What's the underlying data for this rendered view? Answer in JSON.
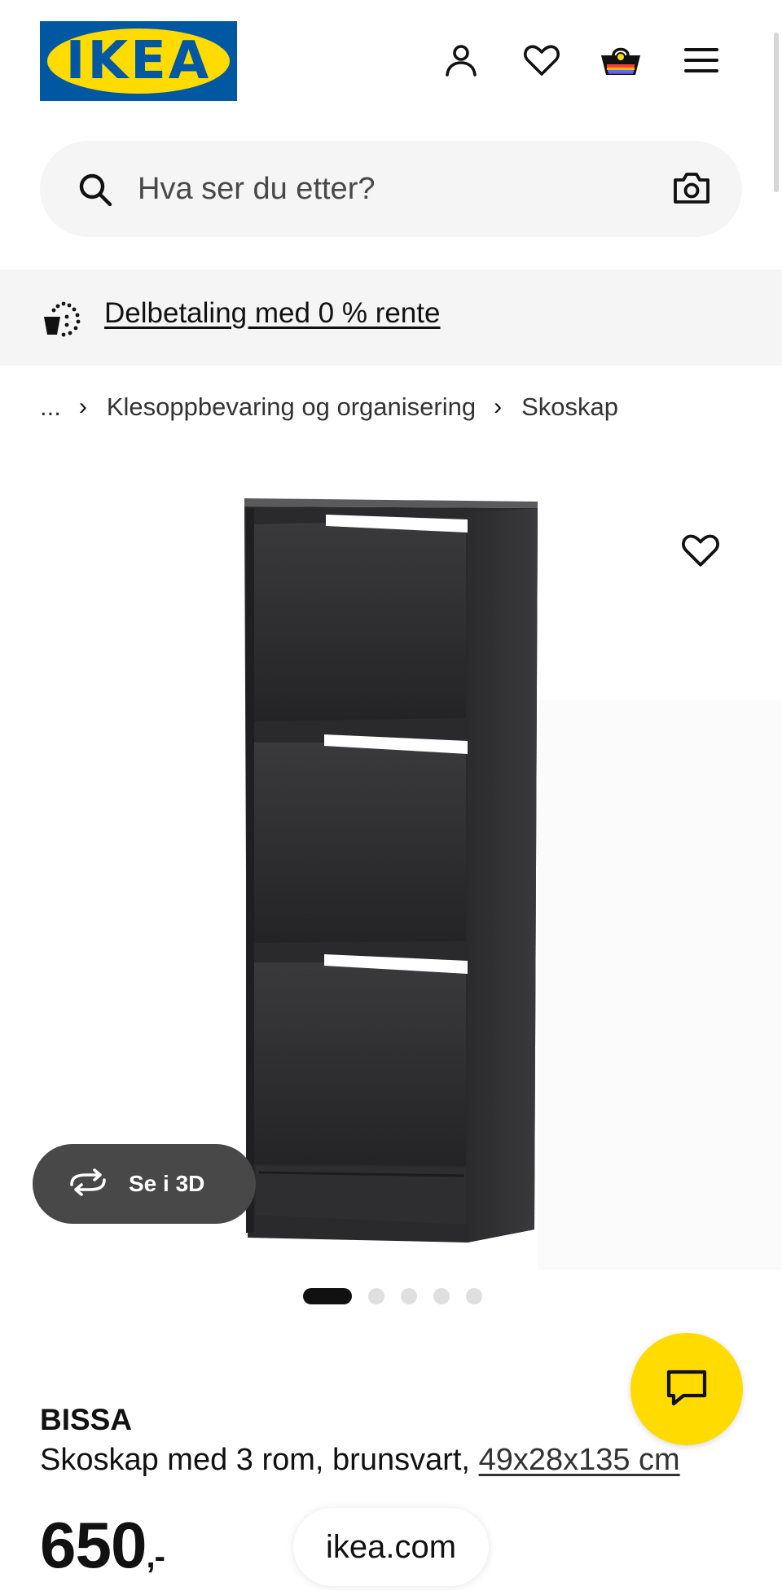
{
  "header": {
    "logo_text": "IKEA",
    "logo_reg": "®",
    "icons": [
      "user-icon",
      "heart-icon",
      "basket-icon",
      "menu-icon"
    ]
  },
  "search": {
    "placeholder": "Hva ser du etter?",
    "icons": [
      "search-icon",
      "camera-icon"
    ]
  },
  "banner": {
    "link_text": "Delbetaling med 0 % rente",
    "icon": "installment-icon"
  },
  "breadcrumb": {
    "ellipsis": "...",
    "separator": "›",
    "items": [
      "Klesoppbevaring og organisering",
      "Skoskap"
    ]
  },
  "gallery": {
    "view_3d_label": "Se i 3D",
    "dot_count": 5,
    "active_dot": 0
  },
  "product": {
    "name": "BISSA",
    "description": "Skoskap med 3 rom, brunsvart, ",
    "dimensions": "49x28x135 cm",
    "price": "650",
    "price_suffix": ",-"
  },
  "browser": {
    "url": "ikea.com"
  },
  "colors": {
    "ikea_blue": "#0058a3",
    "ikea_yellow": "#ffdb00",
    "dark_pill": "#484848"
  }
}
